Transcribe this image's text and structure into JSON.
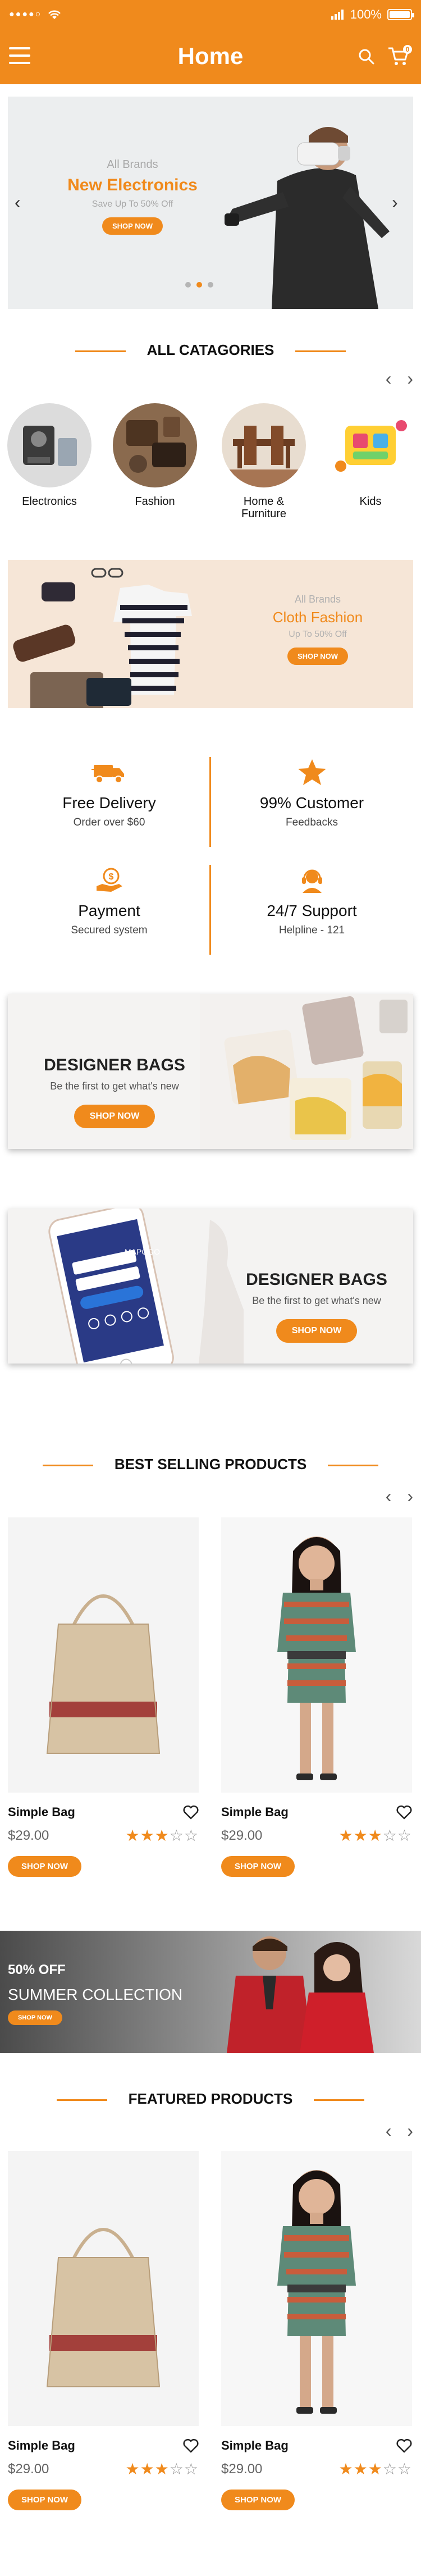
{
  "status": {
    "signal": "●●●●○",
    "battery_pct": "100%"
  },
  "header": {
    "title": "Home",
    "cart_count": "0"
  },
  "hero": {
    "line1": "All Brands",
    "line2": "New Electronics",
    "line3": "Save Up To 50% Off",
    "button": "SHOP NOW",
    "dots_count": 3,
    "active_dot": 1
  },
  "categories": {
    "title": "ALL CATAGORIES",
    "items": [
      {
        "label": "Electronics"
      },
      {
        "label": "Fashion"
      },
      {
        "label": "Home &\nFurniture"
      },
      {
        "label": "Kids"
      }
    ]
  },
  "cloth": {
    "line1": "All Brands",
    "line2": "Cloth Fashion",
    "line3": "Up To 50% Off",
    "button": "SHOP NOW"
  },
  "features": [
    {
      "title": "Free Delivery",
      "sub": "Order over $60",
      "icon": "truck-icon"
    },
    {
      "title": "99% Customer",
      "sub": "Feedbacks",
      "icon": "star-icon"
    },
    {
      "title": "Payment",
      "sub": "Secured system",
      "icon": "payment-icon"
    },
    {
      "title": "24/7 Support",
      "sub": "Helpline - 121",
      "icon": "support-icon"
    }
  ],
  "designer1": {
    "title": "DESIGNER BAGS",
    "sub": "Be the first to get what's new",
    "button": "SHOP NOW"
  },
  "designer2": {
    "title": "DESIGNER BAGS",
    "sub": "Be the first to get what's new",
    "button": "SHOP NOW",
    "phone_brand": "MAPOGO"
  },
  "best_selling": {
    "title": "BEST SELLING PRODUCTS",
    "products": [
      {
        "name": "Simple Bag",
        "price": "$29.00",
        "rating": 3,
        "max_rating": 5,
        "button": "SHOP NOW"
      },
      {
        "name": "Simple Bag",
        "price": "$29.00",
        "rating": 3,
        "max_rating": 5,
        "button": "SHOP NOW"
      }
    ]
  },
  "summer": {
    "line1": "50% OFF",
    "line2": "SUMMER COLLECTION",
    "button": "SHOP NOW"
  },
  "featured": {
    "title": "FEATURED PRODUCTS",
    "products": [
      {
        "name": "Simple Bag",
        "price": "$29.00",
        "rating": 3,
        "max_rating": 5,
        "button": "SHOP NOW"
      },
      {
        "name": "Simple Bag",
        "price": "$29.00",
        "rating": 3,
        "max_rating": 5,
        "button": "SHOP NOW"
      }
    ]
  },
  "colors": {
    "accent": "#f08a1c",
    "text": "#111111",
    "muted": "#666666"
  }
}
